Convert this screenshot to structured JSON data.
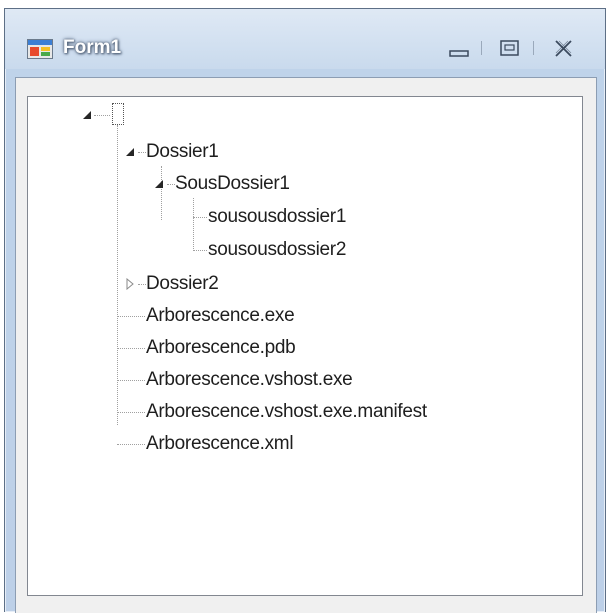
{
  "window": {
    "title": "Form1"
  },
  "tree": {
    "root_label": "",
    "nodes": [
      {
        "label": "Dossier1",
        "expanded": true
      },
      {
        "label": "SousDossier1",
        "expanded": true
      },
      {
        "label": "sousousdossier1"
      },
      {
        "label": "sousousdossier2"
      },
      {
        "label": "Dossier2",
        "expanded": false
      },
      {
        "label": "Arborescence.exe"
      },
      {
        "label": "Arborescence.pdb"
      },
      {
        "label": "Arborescence.vshost.exe"
      },
      {
        "label": "Arborescence.vshost.exe.manifest"
      },
      {
        "label": "Arborescence.xml"
      }
    ]
  },
  "colors": {
    "title_text": "#ffffff",
    "chrome": "#c9daed",
    "client_bg": "#f0f0f0",
    "tree_bg": "#ffffff"
  },
  "icons": {
    "app": "form-app-icon",
    "minimize": "minimize-icon",
    "maximize": "maximize-icon",
    "close": "close-icon",
    "expanded": "expanded-triangle-icon",
    "collapsed": "collapsed-triangle-icon"
  }
}
